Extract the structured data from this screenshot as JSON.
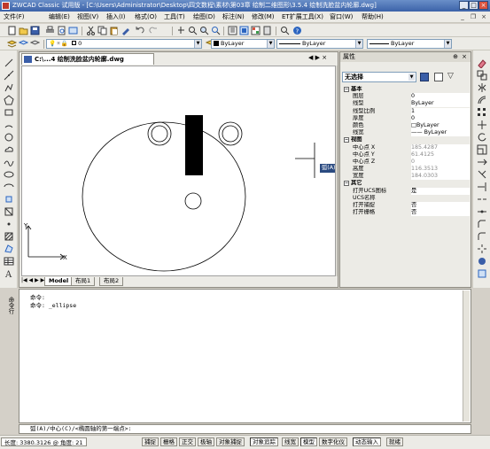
{
  "window": {
    "title": "ZWCAD Classic 试用版 - [C:\\Users\\Administrator\\Desktop\\四文数程\\素材\\第03章 绘制二维图形\\3.5.4  绘制洗脸盆内轮廓.dwg]",
    "min": "_",
    "max": "□",
    "close": "×"
  },
  "menu": {
    "items": [
      "文件(F)",
      "编辑(E)",
      "视图(V)",
      "插入(I)",
      "格式(O)",
      "工具(T)",
      "绘图(D)",
      "标注(N)",
      "修改(M)",
      "ET扩展工具(X)",
      "窗口(W)",
      "帮助(H)"
    ],
    "mdi_min": "_",
    "mdi_restore": "❐",
    "mdi_close": "×"
  },
  "toolbar": {
    "layer_value": "0",
    "color_value": "ByLayer",
    "linetype_value": "ByLayer",
    "lineweight_value": "ByLayer"
  },
  "document": {
    "tab_label": "C:\\...4  绘制洗脸盆内轮廓.dwg",
    "tab_nav": "◀ ▶ × ",
    "layout_tabs": [
      "Model",
      "布局1",
      "布局2"
    ],
    "layout_nav": "|◀ ◀ ▶ ▶|",
    "ucs_y": "Y",
    "ucs_x": "X",
    "tooltip": "弧(A)/中心(C)/<椭圆轴的第一端点>:"
  },
  "properties": {
    "title": "属性",
    "selection": "无选择",
    "categories": [
      {
        "name": "基本",
        "rows": [
          {
            "key": "图层",
            "value": "0"
          },
          {
            "key": "线型",
            "value": "ByLayer"
          },
          {
            "key": "线型比例",
            "value": "1"
          },
          {
            "key": "厚度",
            "value": "0"
          },
          {
            "key": "颜色",
            "value": "□ByLayer"
          },
          {
            "key": "线宽",
            "value": "—— ByLayer"
          }
        ]
      },
      {
        "name": "视图",
        "rows": [
          {
            "key": "中心点 X",
            "value": "185.4287"
          },
          {
            "key": "中心点 Y",
            "value": "61.4125"
          },
          {
            "key": "中心点 Z",
            "value": "0"
          },
          {
            "key": "高度",
            "value": "116.3513"
          },
          {
            "key": "宽度",
            "value": "184.0303"
          }
        ]
      },
      {
        "name": "其它",
        "rows": [
          {
            "key": "打开UCS图标",
            "value": "是"
          },
          {
            "key": "UCS名称",
            "value": ""
          },
          {
            "key": "打开捕捉",
            "value": "否"
          },
          {
            "key": "打开栅格",
            "value": "否"
          }
        ]
      }
    ]
  },
  "command": {
    "label": "命令行",
    "history": [
      "命令:",
      "命令: _ellipse"
    ],
    "prompt": "弧(A)/中心(C)/<椭圆轴的第一端点>:"
  },
  "status": {
    "coord": "长度: 3380.3126 @ 角度: 21",
    "buttons": [
      {
        "label": "捕捉",
        "on": false
      },
      {
        "label": "栅格",
        "on": false
      },
      {
        "label": "正交",
        "on": false
      },
      {
        "label": "极轴",
        "on": false
      },
      {
        "label": "对象捕捉",
        "on": false
      },
      {
        "label": "对象追踪",
        "on": true
      },
      {
        "label": "线宽",
        "on": false
      },
      {
        "label": "模型",
        "on": true
      },
      {
        "label": "数字化仪",
        "on": false
      },
      {
        "label": "动态输入",
        "on": true
      },
      {
        "label": "就绪",
        "on": false
      }
    ]
  }
}
